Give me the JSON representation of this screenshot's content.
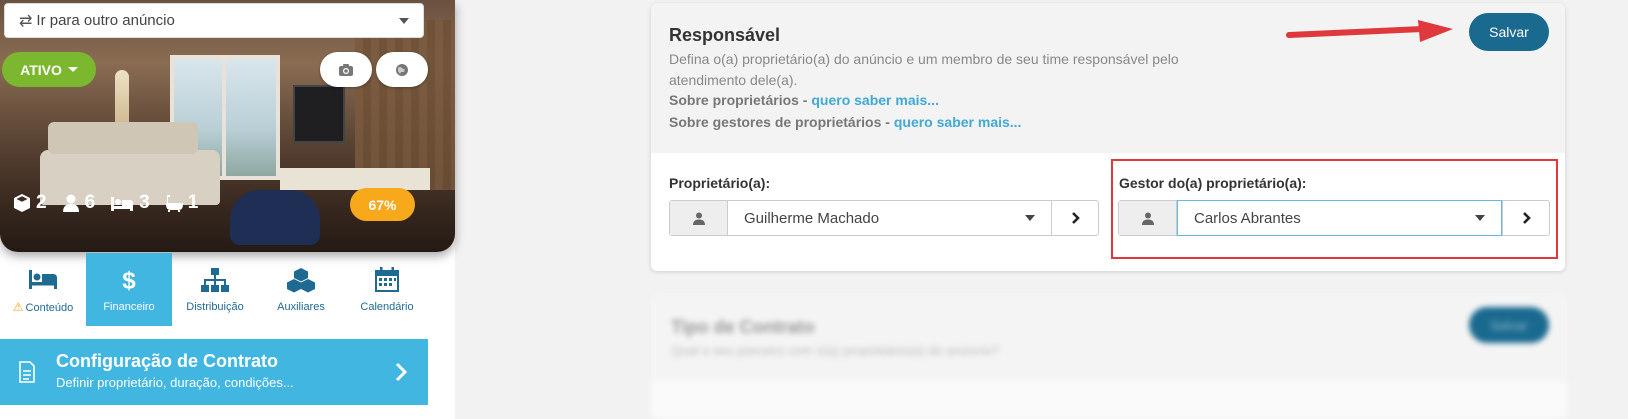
{
  "sidebar": {
    "ad_select": {
      "icon": "swap-arrows-icon",
      "label": "Ir para outro anúncio"
    },
    "status": {
      "label": "ATIVO",
      "color": "#7cb82f"
    },
    "photo_buttons": [
      "camera-icon",
      "globe-icon"
    ],
    "stats": [
      {
        "icon": "cube-icon",
        "value": "2"
      },
      {
        "icon": "user-icon",
        "value": "6"
      },
      {
        "icon": "bed-icon",
        "value": "3"
      },
      {
        "icon": "bathtub-icon",
        "value": "1"
      }
    ],
    "progress": {
      "label": "67%",
      "value": 0.67,
      "color": "#f7a81b"
    },
    "tabs": [
      {
        "icon": "bed-icon",
        "label": "Conteúdo",
        "warning": "⚠",
        "active": false
      },
      {
        "icon": "dollar-icon",
        "label": "Financeiro",
        "active": true
      },
      {
        "icon": "sitemap-icon",
        "label": "Distribuição",
        "active": false
      },
      {
        "icon": "cubes-icon",
        "label": "Auxiliares",
        "active": false
      },
      {
        "icon": "calendar-icon",
        "label": "Calendário",
        "active": false
      }
    ],
    "contract": {
      "title": "Configuração de Contrato",
      "subtitle": "Definir proprietário, duração, condições...",
      "color": "#41b6e0"
    }
  },
  "responsavel": {
    "title": "Responsável",
    "description": "Defina o(a) proprietário(a) do anúncio e um membro de seu time responsável pelo atendimento dele(a).",
    "info_owners": {
      "text": "Sobre proprietários - ",
      "link": "quero saber mais..."
    },
    "info_managers": {
      "text": "Sobre gestores de proprietários - ",
      "link": "quero saber mais..."
    },
    "save_label": "Salvar",
    "owner": {
      "label": "Proprietário(a):",
      "value": "Guilherme Machado"
    },
    "manager": {
      "label": "Gestor do(a) proprietário(a):",
      "value": "Carlos Abrantes"
    },
    "accent_color": "#1a6a90",
    "annotation_color": "#e0393d"
  },
  "blurred_card": {
    "title": "Tipo de Contrato",
    "subtitle": "Qual o seu parceiro com o(a) proprietário(a) do anúncio?",
    "button_label": "Salvar"
  }
}
